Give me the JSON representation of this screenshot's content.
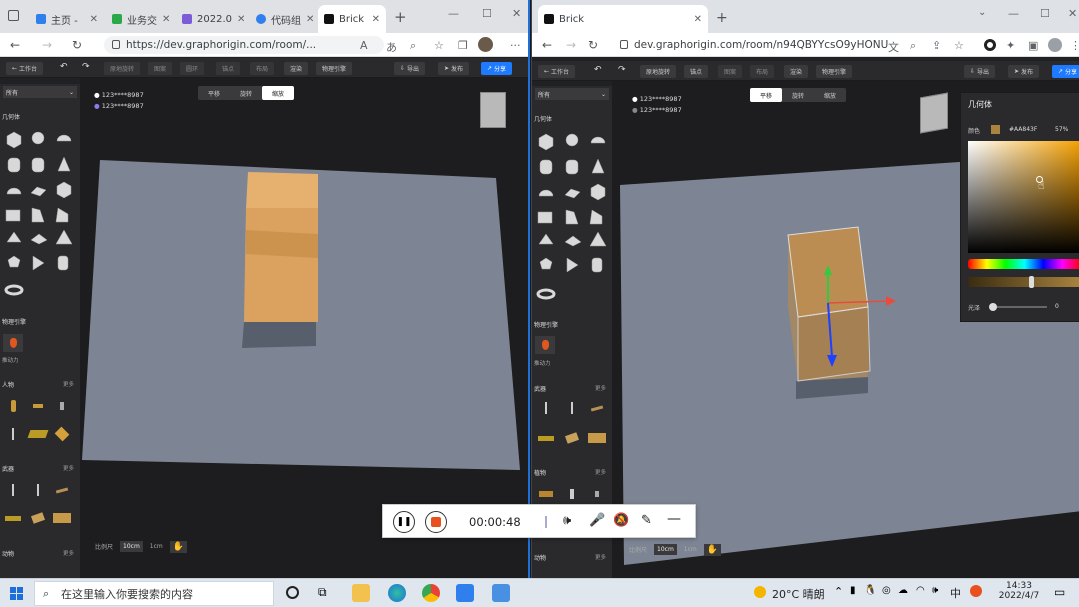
{
  "left": {
    "tabs": [
      {
        "label": "主页 -",
        "color": "#2f80ed"
      },
      {
        "label": "业务交",
        "color": "#2aa84a"
      },
      {
        "label": "2022.0",
        "color": "#7b5cd6"
      },
      {
        "label": "代码组",
        "color": "#2f80ed"
      },
      {
        "label": "Brick",
        "color": "#111111"
      }
    ],
    "url": "https://dev.graphorigin.com/room/...",
    "toolbar": {
      "workspace": "工作台",
      "items": [
        "原地旋转",
        "图案",
        "圆环",
        "锚点",
        "布局",
        "渲染",
        "物理引擎"
      ],
      "export": "导出",
      "publish": "发布",
      "share": "分享"
    },
    "sidebar": {
      "filter": "所有",
      "geometry": "几何体",
      "physics": "物理引擎",
      "physics_item": "推动力",
      "people": "人物",
      "people_more": "更多",
      "weapons": "武器",
      "weapons_more": "更多",
      "animals": "动物",
      "animals_more": "更多"
    },
    "modes": [
      "平移",
      "旋转",
      "缩放"
    ],
    "active_mode": 2,
    "users": [
      "123****8987",
      "123****8987"
    ],
    "scale": {
      "label": "比例尺",
      "a": "10cm",
      "b": "1cm"
    }
  },
  "right": {
    "tab": "Brick",
    "url": "dev.graphorigin.com/room/n94QBYYcsO9yHONU",
    "toolbar": {
      "workspace": "工作台",
      "items": [
        "原地旋转",
        "锚点",
        "图案",
        "布局",
        "渲染",
        "物理引擎"
      ],
      "export": "导出",
      "publish": "发布",
      "share": "分享"
    },
    "sidebar": {
      "filter": "所有",
      "geometry": "几何体",
      "physics": "物理引擎",
      "physics_item": "推动力",
      "weapons": "武器",
      "weapons_more": "更多",
      "animals": "动物",
      "animals_more": "更多"
    },
    "modes": [
      "平移",
      "旋转",
      "缩放"
    ],
    "active_mode": 0,
    "users": [
      "123****8987",
      "123****8987"
    ],
    "scale": {
      "label": "比例尺",
      "a": "10cm",
      "b": "1cm"
    },
    "panel": {
      "title": "几何体",
      "color_label": "颜色",
      "color_hex": "#AA843F",
      "opacity": "57%",
      "gloss_label": "光泽",
      "gloss_value": "0"
    }
  },
  "recorder": {
    "time": "00:00:48"
  },
  "taskbar": {
    "search_placeholder": "在这里输入你要搜索的内容",
    "weather": "20°C 晴朗",
    "time": "14:33",
    "date": "2022/4/7",
    "lang": "中"
  },
  "colors": {
    "accent": "#1e7bff",
    "floor": "#7d8594",
    "box": "#d9a35e"
  }
}
